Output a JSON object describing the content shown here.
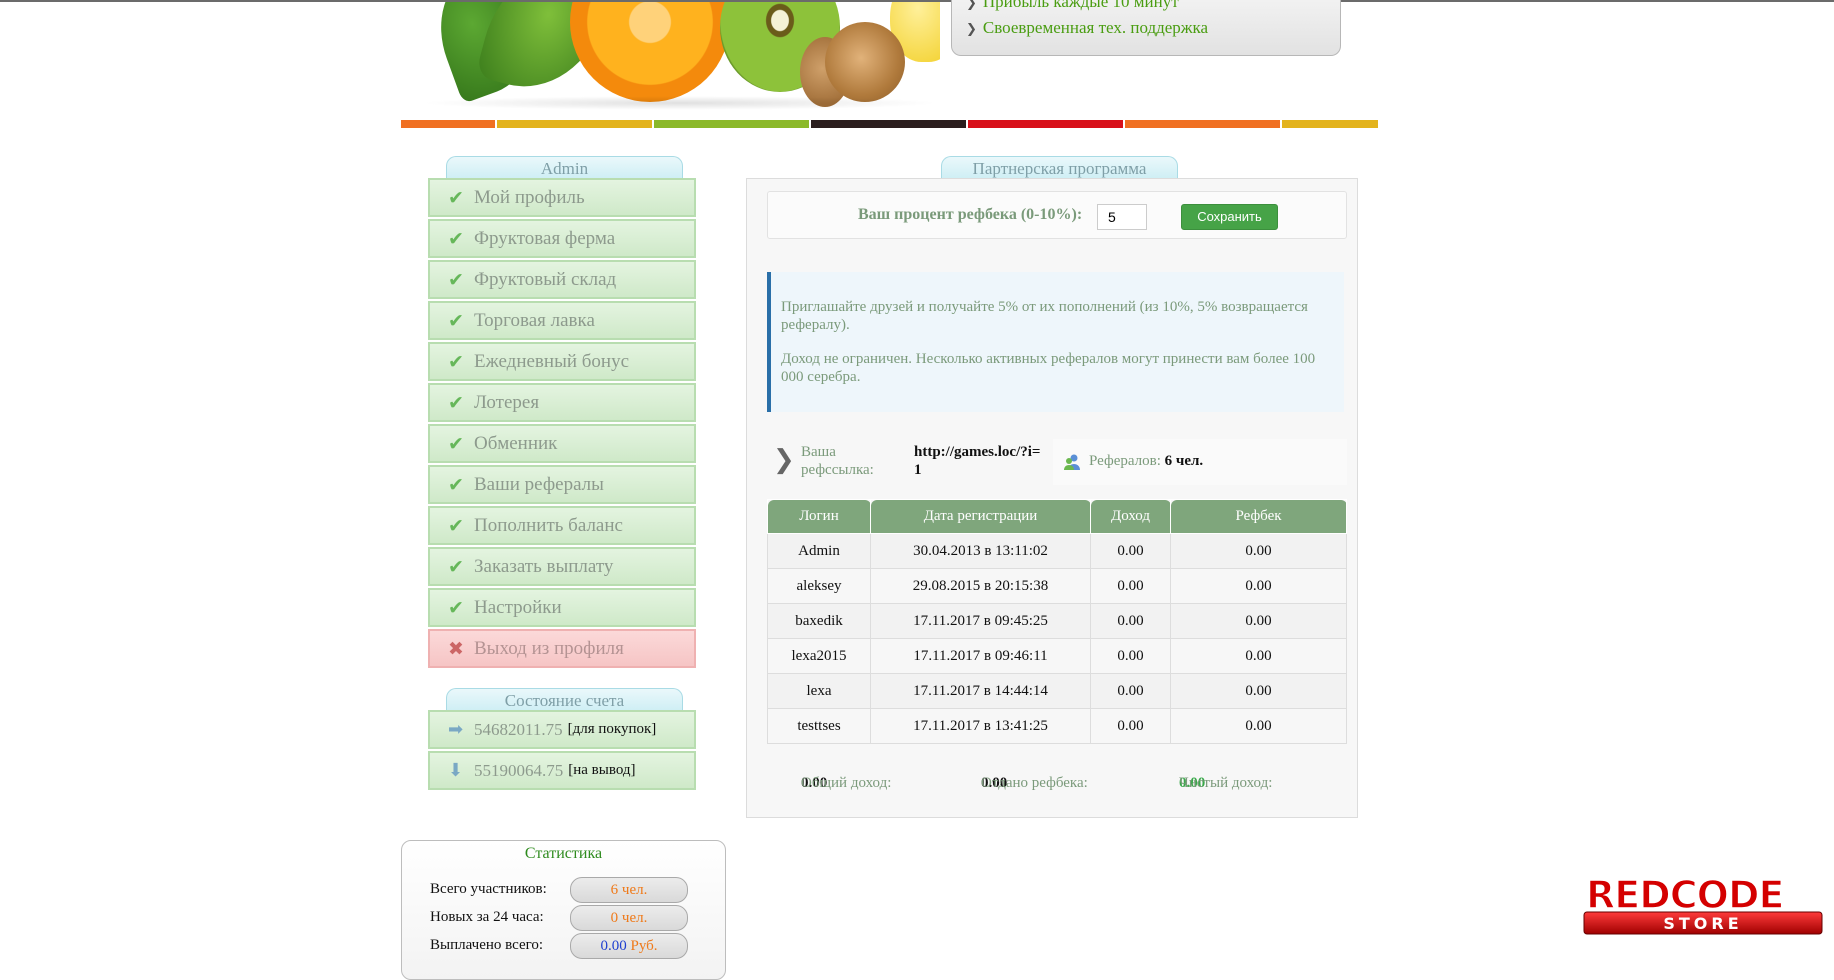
{
  "header": {
    "features": [
      "Прибыль каждые 10 минут",
      "Своевременная тех. поддержка"
    ]
  },
  "colors": {
    "strip": [
      "#f07022",
      "#e3b31d",
      "#8bb92a",
      "#2b1e1e",
      "#d8101a",
      "#f07022",
      "#e3b31d"
    ],
    "menu_green": "#cfe9c9",
    "logout_red": "#f6c5c5",
    "table_header": "#7fa67c",
    "save_button": "#46a347"
  },
  "sidebar": {
    "title": "Admin",
    "items": [
      {
        "label": "Мой профиль",
        "icon": "check-icon"
      },
      {
        "label": "Фруктовая ферма",
        "icon": "check-icon"
      },
      {
        "label": "Фруктовый склад",
        "icon": "check-icon"
      },
      {
        "label": "Торговая лавка",
        "icon": "check-icon"
      },
      {
        "label": "Ежедневный бонус",
        "icon": "check-icon"
      },
      {
        "label": "Лотерея",
        "icon": "check-icon"
      },
      {
        "label": "Обменник",
        "icon": "check-icon"
      },
      {
        "label": "Ваши рефералы",
        "icon": "check-icon"
      },
      {
        "label": "Пополнить баланс",
        "icon": "check-icon"
      },
      {
        "label": "Заказать выплату",
        "icon": "check-icon"
      },
      {
        "label": "Настройки",
        "icon": "check-icon"
      }
    ],
    "logout": {
      "label": "Выход из профиля",
      "icon": "cross-icon"
    }
  },
  "account": {
    "title": "Состояние счета",
    "purchase": {
      "value": "54682011.75",
      "suffix": "[для покупок]",
      "icon": "arrow-right-icon"
    },
    "withdraw": {
      "value": "55190064.75",
      "suffix": "[на вывод]",
      "icon": "arrow-down-icon"
    }
  },
  "stats": {
    "title": "Статистика",
    "rows": [
      {
        "label": "Всего участников:",
        "value": "6 чел."
      },
      {
        "label": "Новых за 24 часа:",
        "value": "0 чел."
      },
      {
        "label": "Выплачено всего:",
        "value": "0.00",
        "unit": "Руб."
      }
    ]
  },
  "partner": {
    "title": "Партнерская программа",
    "percent_label": "Ваш процент рефбека (0-10%):",
    "percent_value": "5",
    "save_label": "Сохранить",
    "info": [
      "Приглашайте друзей и получайте 5% от их пополнений (из 10%, 5% возвращается рефералу).",
      "Доход не ограничен. Несколько активных рефералов могут принести вам более 100 000 серебра."
    ],
    "link_label": "Ваша рефссылка:",
    "link_value": "http://games.loc/?i=1",
    "referrals_label": "Рефералов:",
    "referrals_value": "6 чел.",
    "table": {
      "headers": [
        "Логин",
        "Дата регистрации",
        "Доход",
        "Рефбек"
      ],
      "rows": [
        [
          "Admin",
          "30.04.2013 в 13:11:02",
          "0.00",
          "0.00"
        ],
        [
          "aleksey",
          "29.08.2015 в 20:15:38",
          "0.00",
          "0.00"
        ],
        [
          "baxedik",
          "17.11.2017 в 09:45:25",
          "0.00",
          "0.00"
        ],
        [
          "lexa2015",
          "17.11.2017 в 09:46:11",
          "0.00",
          "0.00"
        ],
        [
          "lexa",
          "17.11.2017 в 14:44:14",
          "0.00",
          "0.00"
        ],
        [
          "testtses",
          "17.11.2017 в 13:41:25",
          "0.00",
          "0.00"
        ]
      ]
    },
    "totals": {
      "total_label": "Общий доход:",
      "total_value": "0.00",
      "given_label": "Отдано рефбека:",
      "given_value": "0.00",
      "net_label": "Чистый доход:",
      "net_value": "0.00"
    }
  },
  "watermark": {
    "line1": "REDCODE",
    "line2": "STORE"
  }
}
